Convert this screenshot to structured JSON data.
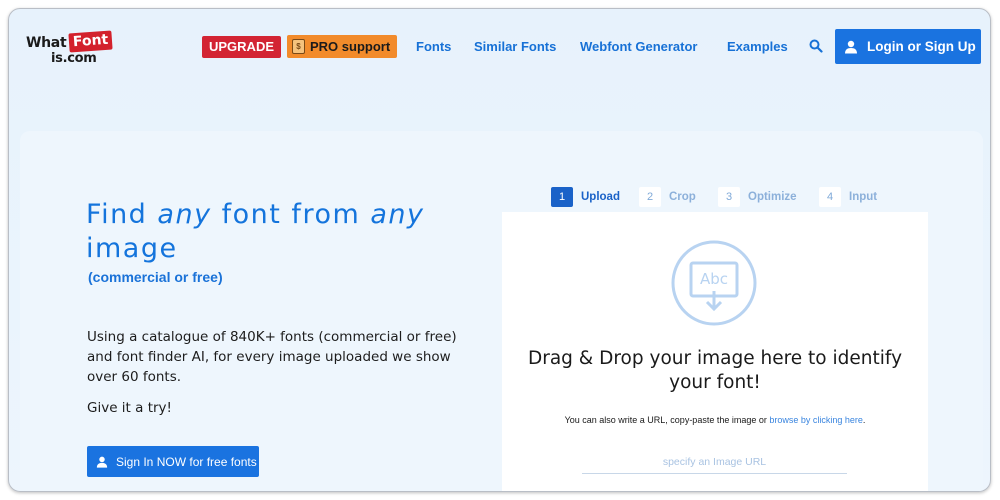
{
  "header": {
    "logo": {
      "word1": "What",
      "word2": "Font",
      "word3": "is.com"
    },
    "upgrade_label": "UPGRADE",
    "pro_label": "PRO support",
    "nav": [
      "Fonts",
      "Similar Fonts",
      "Webfont Generator",
      "Examples"
    ],
    "login_label": "Login or Sign Up"
  },
  "hero": {
    "title_1": "Find ",
    "title_any_1": "any",
    "title_2": " font from ",
    "title_any_2": "any",
    "title_3": "image",
    "subtitle": "(commercial or free)",
    "description": "Using a catalogue of 840K+ fonts (commercial or free) and font finder AI, for every image uploaded we show over 60 fonts.",
    "try_text": "Give it a try!",
    "signin_label": "Sign In NOW for free fonts"
  },
  "steps": [
    {
      "num": "1",
      "label": "Upload",
      "active": true
    },
    {
      "num": "2",
      "label": "Crop",
      "active": false
    },
    {
      "num": "3",
      "label": "Optimize",
      "active": false
    },
    {
      "num": "4",
      "label": "Input",
      "active": false
    }
  ],
  "upload": {
    "icon_text": "Abc",
    "title": "Drag & Drop your image here to identify your font!",
    "hint_prefix": "You can also write a URL, copy-paste the image or ",
    "hint_link": "browse by clicking here",
    "hint_suffix": ".",
    "url_placeholder": "specify an Image URL"
  },
  "colors": {
    "accent": "#1a73e0",
    "upgrade": "#d32433",
    "pro": "#f28b2b",
    "link": "#1771d6",
    "background": "#e7f2fc"
  },
  "icons": {
    "search": "search-icon",
    "user": "user-icon",
    "upload": "image-upload-icon"
  }
}
